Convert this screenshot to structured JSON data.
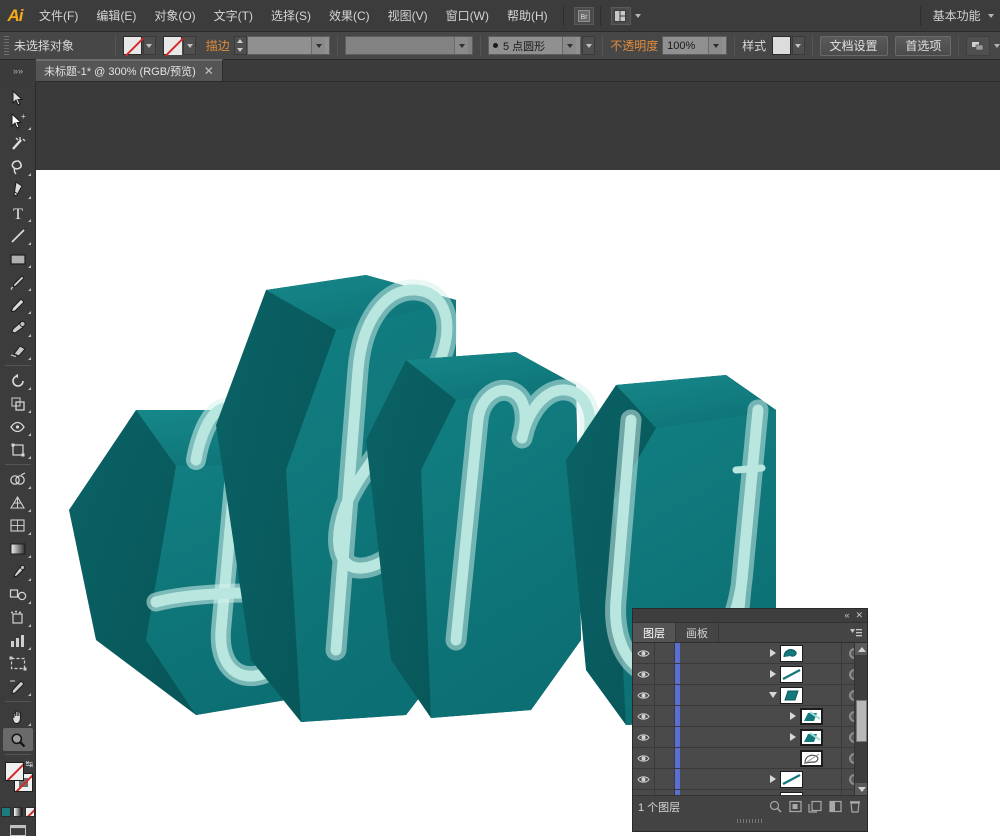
{
  "app": {
    "logo": "Ai",
    "workspace": "基本功能"
  },
  "menubar": {
    "items": [
      {
        "label": "文件(F)",
        "name": "menu-file"
      },
      {
        "label": "编辑(E)",
        "name": "menu-edit"
      },
      {
        "label": "对象(O)",
        "name": "menu-object"
      },
      {
        "label": "文字(T)",
        "name": "menu-type"
      },
      {
        "label": "选择(S)",
        "name": "menu-select"
      },
      {
        "label": "效果(C)",
        "name": "menu-effect"
      },
      {
        "label": "视图(V)",
        "name": "menu-view"
      },
      {
        "label": "窗口(W)",
        "name": "menu-window"
      },
      {
        "label": "帮助(H)",
        "name": "menu-help"
      }
    ],
    "bridge_icon": "bridge-icon",
    "arrange_doc_icon": "arrange-documents-icon"
  },
  "controlbar": {
    "selection_status": "未选择对象",
    "fill_swatch": "none-swatch",
    "stroke_swatch": "none-swatch",
    "stroke_label": "描边",
    "stroke_weight": "",
    "brush_definition": "",
    "stroke_profile": "",
    "variable_width_value": "5 点圆形",
    "opacity_label": "不透明度",
    "opacity_value": "100%",
    "style_label": "样式",
    "document_setup": "文档设置",
    "preferences": "首选项",
    "arrange_icon": "arrange-icon"
  },
  "tabbar": {
    "collapse_icon": "collapse-panel-icon",
    "document_tab": "未标题-1* @ 300% (RGB/预览)",
    "close_icon": "close-icon"
  },
  "toolbar": {
    "tools": [
      {
        "name": "selection-tool",
        "icon": "arrow-cursor-icon",
        "active": false
      },
      {
        "name": "direct-selection-tool",
        "icon": "white-arrow-icon",
        "active": false
      },
      {
        "name": "magic-wand-tool",
        "icon": "magic-wand-icon",
        "active": false
      },
      {
        "name": "lasso-tool",
        "icon": "lasso-icon",
        "active": false
      },
      {
        "name": "pen-tool",
        "icon": "pen-icon",
        "active": false
      },
      {
        "name": "type-tool",
        "icon": "type-t-icon",
        "active": false
      },
      {
        "name": "line-segment-tool",
        "icon": "line-icon",
        "active": false
      },
      {
        "name": "rectangle-tool",
        "icon": "rectangle-icon",
        "active": false
      },
      {
        "name": "paintbrush-tool",
        "icon": "paintbrush-icon",
        "active": false
      },
      {
        "name": "pencil-tool",
        "icon": "pencil-icon",
        "active": false
      },
      {
        "name": "blob-brush-tool",
        "icon": "blob-brush-icon",
        "active": false
      },
      {
        "name": "eraser-tool",
        "icon": "eraser-icon",
        "active": false
      },
      {
        "name": "rotate-tool",
        "icon": "rotate-icon",
        "active": false
      },
      {
        "name": "scale-tool",
        "icon": "scale-icon",
        "active": false
      },
      {
        "name": "width-tool",
        "icon": "width-icon",
        "active": false
      },
      {
        "name": "free-transform-tool",
        "icon": "free-transform-icon",
        "active": false
      },
      {
        "name": "shape-builder-tool",
        "icon": "shape-builder-icon",
        "active": false
      },
      {
        "name": "perspective-grid-tool",
        "icon": "perspective-grid-icon",
        "active": false
      },
      {
        "name": "mesh-tool",
        "icon": "mesh-icon",
        "active": false
      },
      {
        "name": "gradient-tool",
        "icon": "gradient-icon",
        "active": false
      },
      {
        "name": "eyedropper-tool",
        "icon": "eyedropper-icon",
        "active": false
      },
      {
        "name": "blend-tool",
        "icon": "blend-icon",
        "active": false
      },
      {
        "name": "symbol-sprayer-tool",
        "icon": "symbol-sprayer-icon",
        "active": false
      },
      {
        "name": "column-graph-tool",
        "icon": "column-graph-icon",
        "active": false
      },
      {
        "name": "artboard-tool",
        "icon": "artboard-icon",
        "active": false
      },
      {
        "name": "slice-tool",
        "icon": "slice-icon",
        "active": false
      },
      {
        "name": "hand-tool",
        "icon": "hand-icon",
        "active": false
      },
      {
        "name": "zoom-tool",
        "icon": "magnifier-icon",
        "active": true
      }
    ],
    "fill_stroke": {
      "fill": "none-swatch",
      "stroke": "none-swatch",
      "swap_icon": "swap-fill-stroke-icon"
    },
    "color_modes": [
      "color-swatch",
      "gradient-swatch",
      "none-swatch"
    ],
    "screen_mode_icon": "screen-mode-icon"
  },
  "artwork": {
    "text": "thru",
    "face_color": "#0f7a7d",
    "side_color": "#0a6164",
    "dark_color": "#07504f",
    "outline_color": "#b5e6df",
    "glow_color": "#d8f2ee",
    "background": "#ffffff"
  },
  "layers_panel": {
    "collapse_icon": "collapse-icon",
    "close_icon": "close-icon",
    "tabs": [
      {
        "label": "图层",
        "name": "tab-layers",
        "active": true
      },
      {
        "label": "画板",
        "name": "tab-artboards",
        "active": false
      }
    ],
    "menu_icon": "panel-menu-icon",
    "rows": [
      {
        "name": "layer-row-1",
        "visible": true,
        "expand": "right",
        "indent": 0,
        "thumb": "teal-swatch-curve",
        "selected": false
      },
      {
        "name": "layer-row-2",
        "visible": true,
        "expand": "right",
        "indent": 0,
        "thumb": "teal-diagonal-line",
        "selected": false
      },
      {
        "name": "layer-row-3",
        "visible": true,
        "expand": "down",
        "indent": 0,
        "thumb": "teal-block",
        "selected": false
      },
      {
        "name": "layer-row-4",
        "visible": true,
        "expand": "right",
        "indent": 1,
        "thumb": "teal-block-sel",
        "selected": true
      },
      {
        "name": "layer-row-5",
        "visible": true,
        "expand": "right",
        "indent": 1,
        "thumb": "teal-block-sel",
        "selected": true
      },
      {
        "name": "layer-row-6",
        "visible": true,
        "expand": "none",
        "indent": 1,
        "thumb": "outline-shape-sel",
        "selected": true
      },
      {
        "name": "layer-row-7",
        "visible": true,
        "expand": "right",
        "indent": 0,
        "thumb": "teal-diagonal-line",
        "selected": false
      }
    ],
    "scroll": {
      "up_icon": "scroll-up-icon",
      "down_icon": "scroll-down-icon"
    },
    "footer": {
      "count": "1 个图层",
      "icons": [
        {
          "name": "locate-object-icon"
        },
        {
          "name": "make-clipping-mask-icon"
        },
        {
          "name": "create-new-sublayer-icon"
        },
        {
          "name": "create-new-layer-icon"
        },
        {
          "name": "delete-selection-icon"
        }
      ]
    }
  }
}
